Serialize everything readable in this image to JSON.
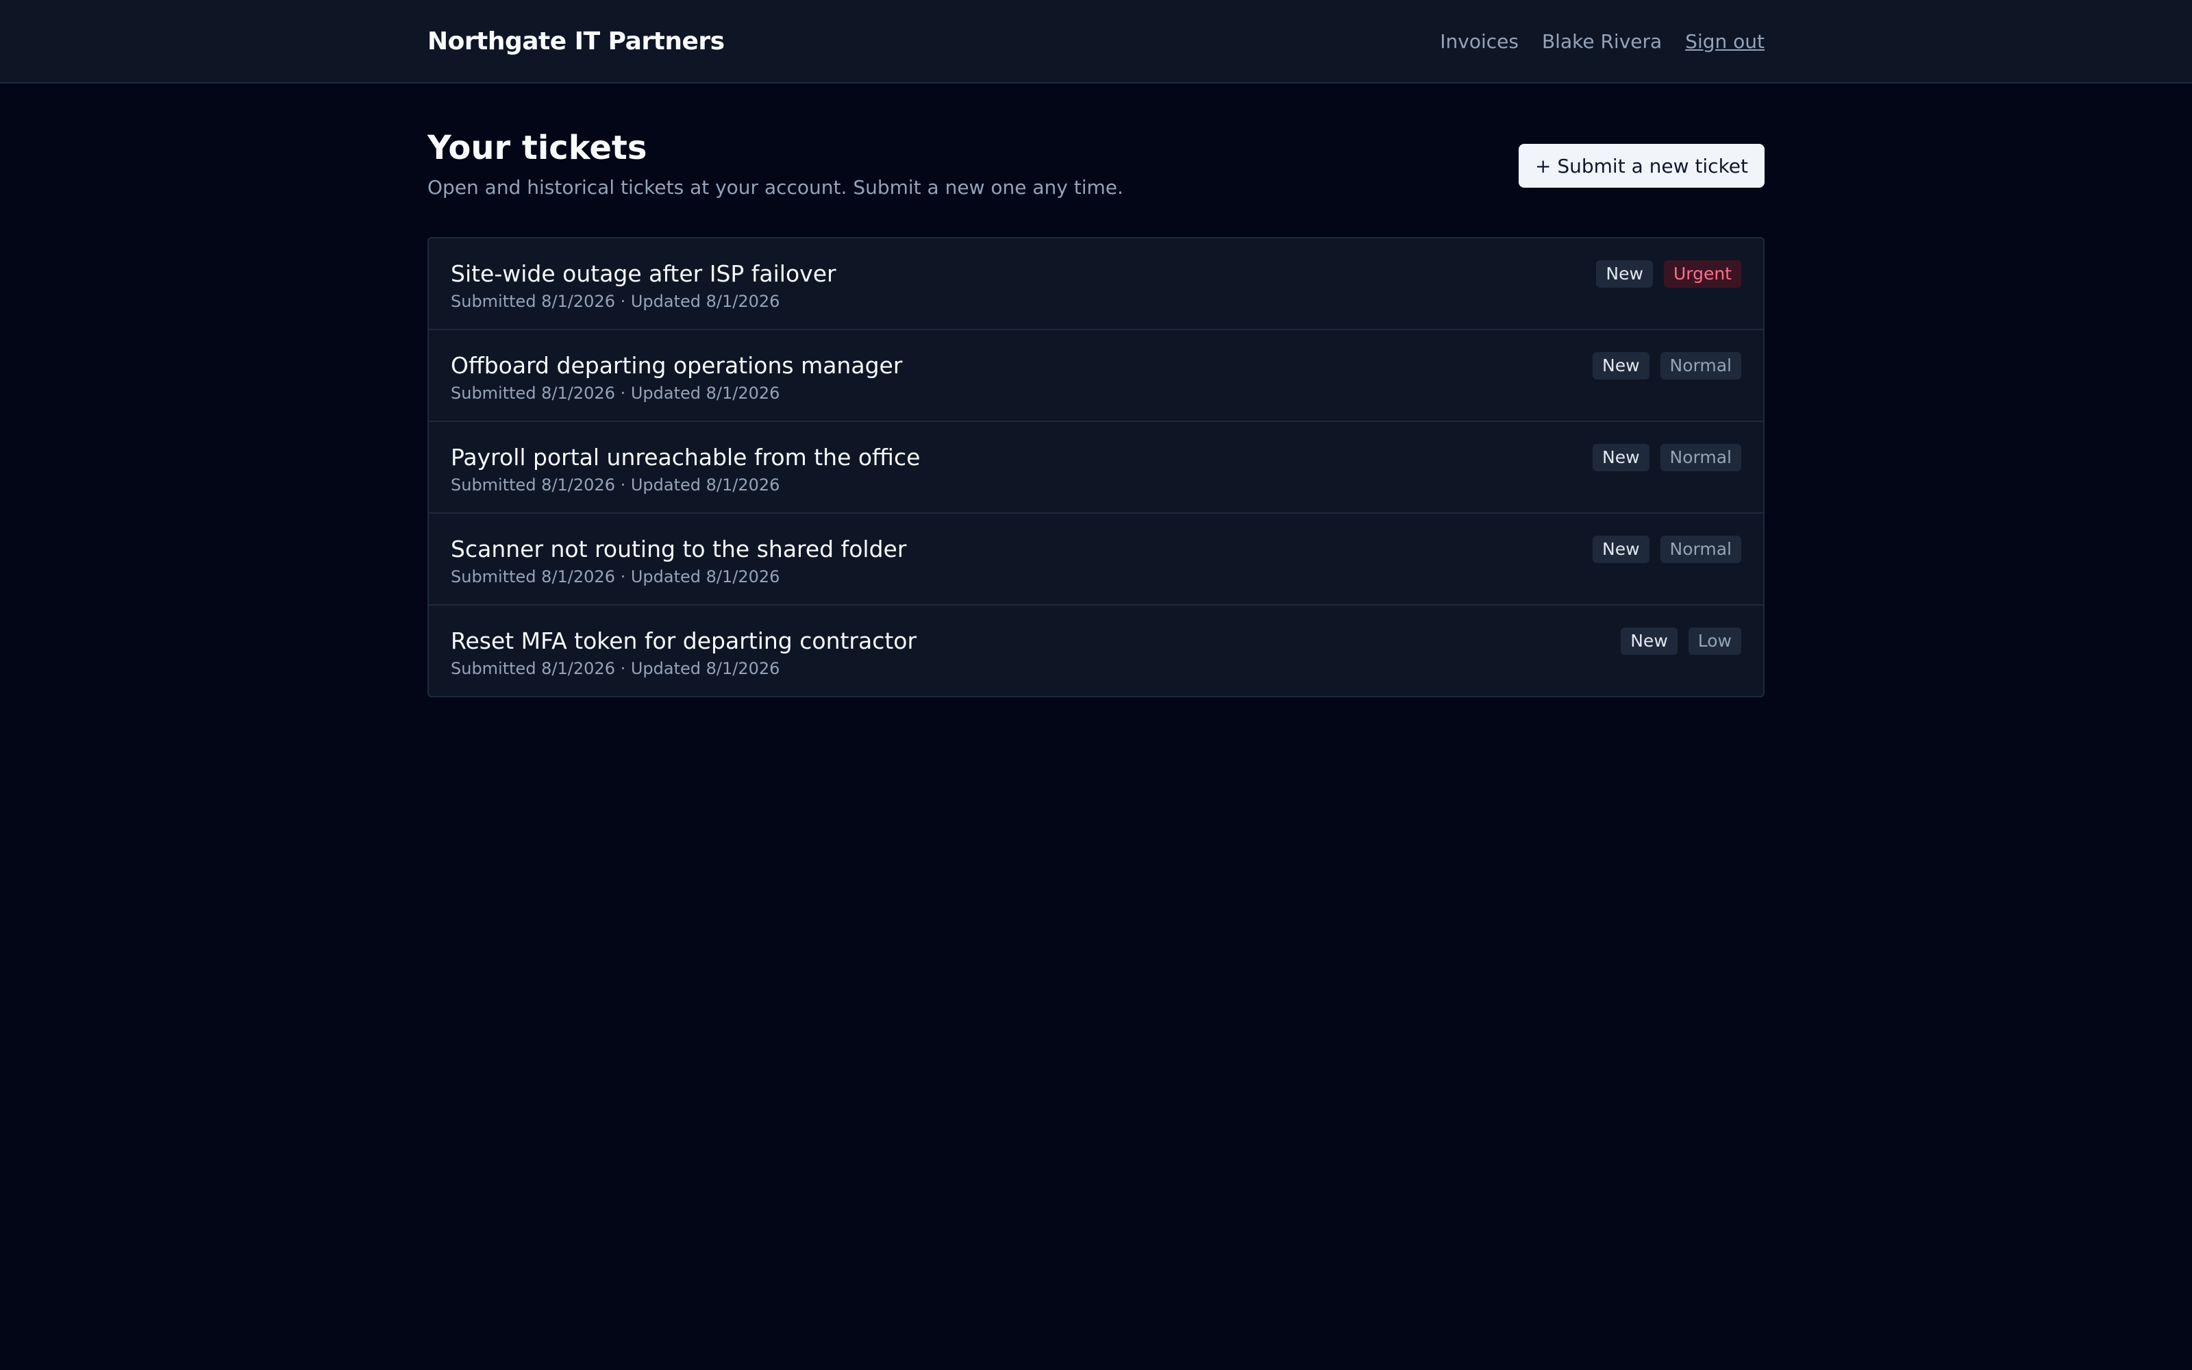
{
  "header": {
    "brand": "Northgate IT Partners",
    "nav_invoices": "Invoices",
    "user_name": "Blake Rivera",
    "sign_out": "Sign out"
  },
  "page": {
    "title": "Your tickets",
    "subtitle": "Open and historical tickets at your account. Submit a new one any time.",
    "new_ticket_label": "+ Submit a new ticket"
  },
  "tickets": [
    {
      "title": "Site-wide outage after ISP failover",
      "meta": "Submitted 8/1/2026 · Updated 8/1/2026",
      "status": "New",
      "priority": "Urgent"
    },
    {
      "title": "Offboard departing operations manager",
      "meta": "Submitted 8/1/2026 · Updated 8/1/2026",
      "status": "New",
      "priority": "Normal"
    },
    {
      "title": "Payroll portal unreachable from the office",
      "meta": "Submitted 8/1/2026 · Updated 8/1/2026",
      "status": "New",
      "priority": "Normal"
    },
    {
      "title": "Scanner not routing to the shared folder",
      "meta": "Submitted 8/1/2026 · Updated 8/1/2026",
      "status": "New",
      "priority": "Normal"
    },
    {
      "title": "Reset MFA token for departing contractor",
      "meta": "Submitted 8/1/2026 · Updated 8/1/2026",
      "status": "New",
      "priority": "Low"
    }
  ],
  "colors": {
    "background": "#020617",
    "surface": "#0e1626",
    "border": "#1e293b",
    "urgent_bg": "#3b1424",
    "urgent_text": "#fb7185",
    "muted_text": "#94a3b8"
  }
}
